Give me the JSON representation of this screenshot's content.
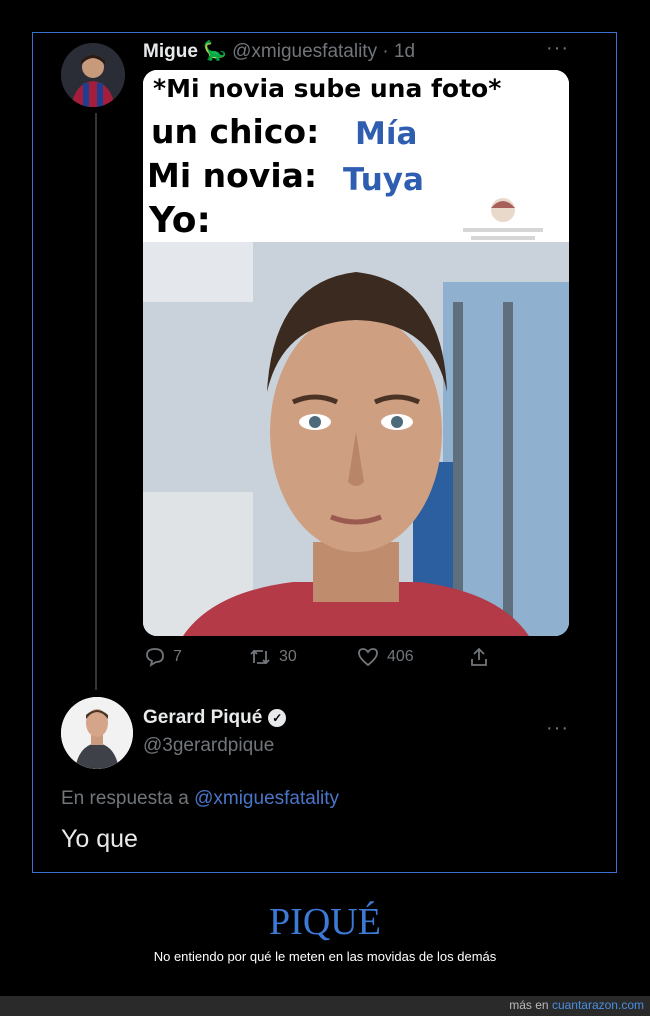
{
  "tweet1": {
    "display_name": "Migue",
    "handle": "@xmiguesfatality",
    "separator": "·",
    "time": "1d",
    "more": "···",
    "meme_text": {
      "line1": "*Mi novia sube una foto*",
      "line2_label": "un chico:",
      "line2_value": "Mía",
      "line3_label": "Mi novia:",
      "line3_value": "Tuya",
      "line4_label": "Yo:"
    },
    "actions": {
      "replies": "7",
      "retweets": "30",
      "likes": "406"
    }
  },
  "tweet2": {
    "display_name": "Gerard Piqué",
    "handle": "@3gerardpique",
    "more": "···",
    "reply_prefix": "En respuesta a",
    "reply_to": "@xmiguesfatality",
    "text": "Yo que"
  },
  "page": {
    "title": "PIQUÉ",
    "subtitle": "No entiendo por qué le meten en las movidas de los demás"
  },
  "footer": {
    "prefix": "más en",
    "site": "cuantarazon.com"
  },
  "colors": {
    "accent_blue": "#3d7ad6",
    "frame_border": "#3b6fd0",
    "link": "#4a76c9"
  }
}
